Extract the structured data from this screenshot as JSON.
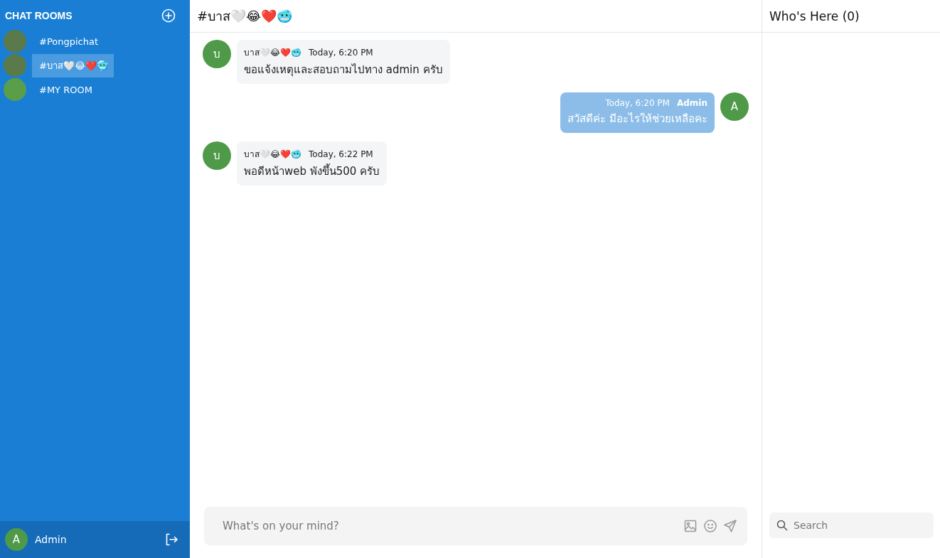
{
  "sidebar": {
    "title": "CHAT ROOMS",
    "rooms": [
      {
        "hash": "#",
        "name": "Pongpichat",
        "kind": "photo",
        "selected": false
      },
      {
        "hash": "#",
        "name": "บาส🤍😂❤️🥶",
        "kind": "photo",
        "selected": true
      },
      {
        "hash": "#",
        "name": "MY ROOM",
        "kind": "plain",
        "selected": false
      }
    ],
    "user": {
      "initial": "A",
      "name": "Admin"
    }
  },
  "chat": {
    "title": "#บาส🤍😂❤️🥶",
    "messages": [
      {
        "kind": "incoming",
        "initial": "บ",
        "sender": "บาส🤍😂❤️🥶",
        "time": "Today, 6:20 PM",
        "text": "ขอแจ้งเหตุและสอบถามไปทาง admin ครับ"
      },
      {
        "kind": "outgoing",
        "initial": "A",
        "sender": "Admin",
        "time": "Today, 6:20 PM",
        "text": "สวัสดีค่ะ มีอะไรให้ช่วยเหลือคะ"
      },
      {
        "kind": "incoming",
        "initial": "บ",
        "sender": "บาส🤍😂❤️🥶",
        "time": "Today, 6:22 PM",
        "text": "พอดีหน้าweb พังขึ้น500 ครับ"
      }
    ],
    "composer": {
      "placeholder": "What's on your mind?"
    }
  },
  "members": {
    "title": "Who's Here (0)",
    "search": {
      "placeholder": "Search"
    }
  }
}
